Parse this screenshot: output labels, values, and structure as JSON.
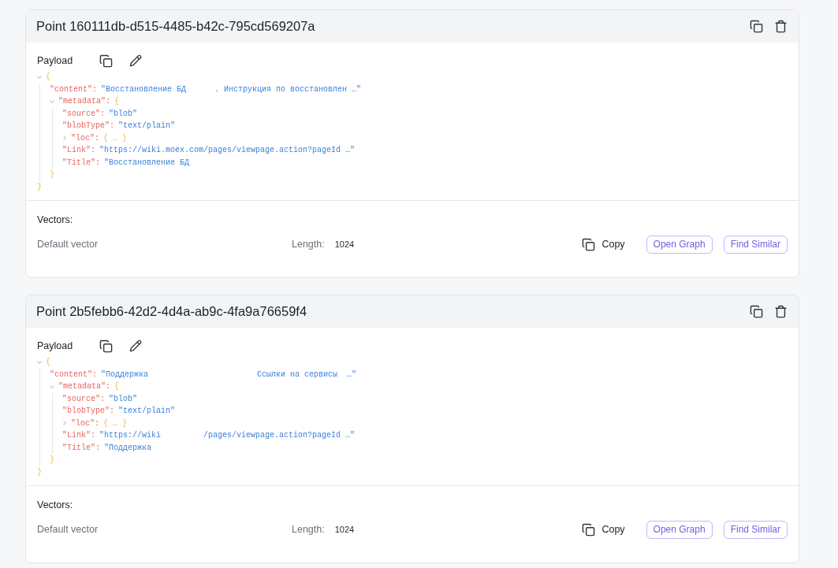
{
  "points": [
    {
      "title": "Point 160111db-d515-4485-b42c-795cd569207a",
      "payload": {
        "label": "Payload",
        "tree": {
          "open": "{",
          "close": "}",
          "expanded": true,
          "children": [
            {
              "key": "\"content\":",
              "value": "\"Восстановление БД      . Инструкция по восстановлен …\""
            },
            {
              "key": "\"metadata\":",
              "open": "{",
              "close": "}",
              "expanded": true,
              "children": [
                {
                  "key": "\"source\":",
                  "value": "\"blob\""
                },
                {
                  "key": "\"blobType\":",
                  "value": "\"text/plain\""
                },
                {
                  "key": "\"loc\":",
                  "expanded": false,
                  "preview": "{ … }"
                },
                {
                  "key": "\"Link\":",
                  "value": "\"https://wiki.moex.com/pages/viewpage.action?pageId …\""
                },
                {
                  "key": "\"Title\":",
                  "value": "\"Восстановление БД"
                }
              ]
            }
          ]
        }
      },
      "vectors": {
        "label": "Vectors:",
        "rows": [
          {
            "name": "Default vector",
            "length_label": "Length:",
            "length": "1024",
            "copy": "Copy",
            "buttons": [
              "Open Graph",
              "Find Similar"
            ]
          }
        ]
      }
    },
    {
      "title": "Point 2b5febb6-42d2-4d4a-ab9c-4fa9a76659f4",
      "payload": {
        "label": "Payload",
        "tree": {
          "open": "{",
          "close": "}",
          "expanded": true,
          "children": [
            {
              "key": "\"content\":",
              "value": "\"Поддержка                       Ссылки на сервисы  …\""
            },
            {
              "key": "\"metadata\":",
              "open": "{",
              "close": "}",
              "expanded": true,
              "children": [
                {
                  "key": "\"source\":",
                  "value": "\"blob\""
                },
                {
                  "key": "\"blobType\":",
                  "value": "\"text/plain\""
                },
                {
                  "key": "\"loc\":",
                  "expanded": false,
                  "preview": "{ … }"
                },
                {
                  "key": "\"Link\":",
                  "value": "\"https://wiki         /pages/viewpage.action?pageId …\""
                },
                {
                  "key": "\"Title\":",
                  "value": "\"Поддержка"
                }
              ]
            }
          ]
        }
      },
      "vectors": {
        "label": "Vectors:",
        "rows": [
          {
            "name": "Default vector",
            "length_label": "Length:",
            "length": "1024",
            "copy": "Copy",
            "buttons": [
              "Open Graph",
              "Find Similar"
            ]
          }
        ]
      }
    }
  ]
}
